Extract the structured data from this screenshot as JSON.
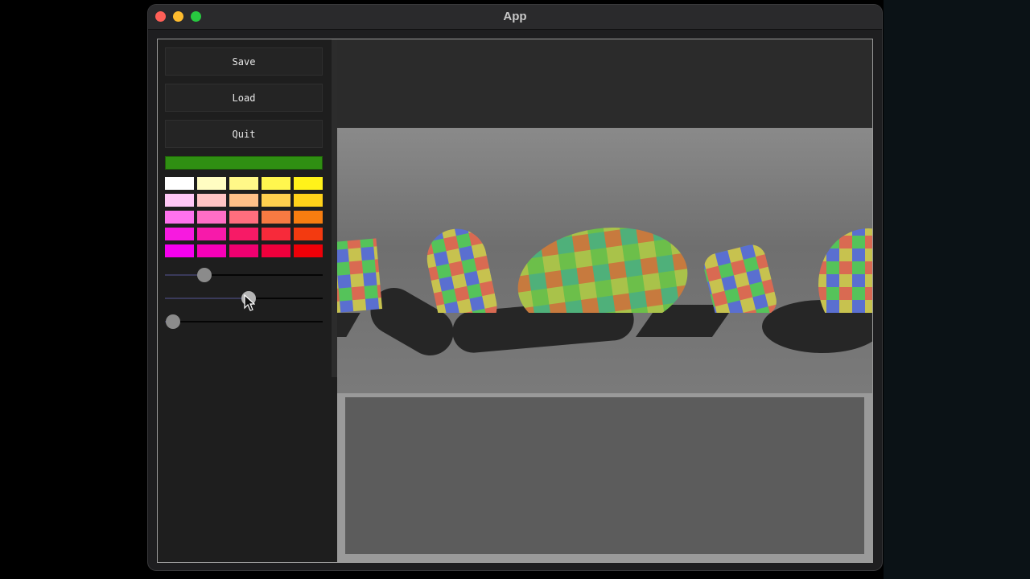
{
  "window": {
    "title": "App"
  },
  "buttons": {
    "save": "Save",
    "load": "Load",
    "quit": "Quit"
  },
  "colors": {
    "selected": "#2f8f12",
    "palette": [
      [
        "#ffffff",
        "#fffdc2",
        "#fff888",
        "#fff64e",
        "#fff21a"
      ],
      [
        "#ffc8f6",
        "#ffc4c4",
        "#ffc088",
        "#ffd04e",
        "#ffd21a"
      ],
      [
        "#ff72ee",
        "#ff6ec6",
        "#ff6e7e",
        "#f77a42",
        "#f77d10"
      ],
      [
        "#f71ae0",
        "#f71aaa",
        "#f71a66",
        "#f72a3a",
        "#f33a10"
      ],
      [
        "#f700f0",
        "#f700b8",
        "#f00070",
        "#f0003c",
        "#ee0008"
      ]
    ]
  },
  "sliders": [
    {
      "name": "slider-1",
      "value": 0.25
    },
    {
      "name": "slider-2",
      "value": 0.53,
      "active": true
    },
    {
      "name": "slider-3",
      "value": 0.05
    }
  ],
  "icons": [
    "close-icon",
    "minimize-icon",
    "maximize-icon",
    "pointer-cursor-icon"
  ]
}
